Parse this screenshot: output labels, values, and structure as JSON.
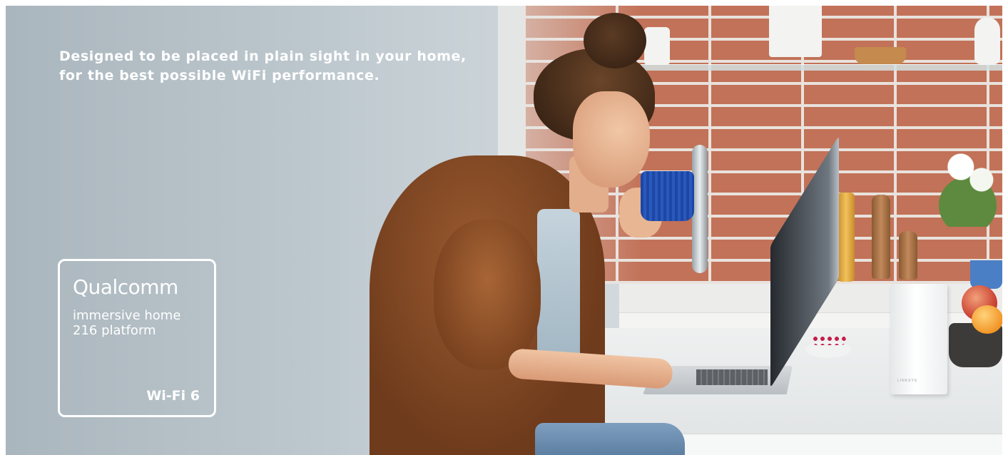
{
  "hero": {
    "tagline_line1": "Designed to be placed in plain sight in your home,",
    "tagline_line2": "for the best possible WiFi performance."
  },
  "badge": {
    "brand": "Qualcomm",
    "line1": "immersive home",
    "line2": "216 platform",
    "wifi": "Wi-Fi 6"
  },
  "router": {
    "brand": "LINKSYS"
  },
  "colors": {
    "text": "#ffffff",
    "mug": "#2a59bd",
    "cardigan": "#7a421f"
  }
}
